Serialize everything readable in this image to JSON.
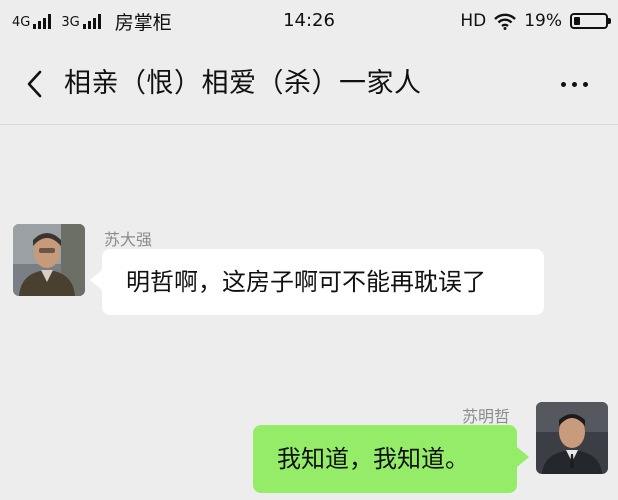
{
  "status_bar": {
    "network1": "4G",
    "network2": "3G",
    "carrier": "房掌柜",
    "time": "14:26",
    "hd": "HD",
    "battery_percent": "19%",
    "battery_level": 0.19
  },
  "header": {
    "title": "相亲（恨）相爱（杀）一家人",
    "back_icon": "chevron-left-icon",
    "more_icon": "more-dots-icon"
  },
  "messages": [
    {
      "sender": "苏大强",
      "text": "明哲啊，这房子啊可不能再耽误了",
      "direction": "incoming"
    },
    {
      "sender": "苏明哲",
      "text": "我知道，我知道。",
      "direction": "outgoing"
    }
  ],
  "colors": {
    "background": "#ededed",
    "incoming_bubble": "#ffffff",
    "outgoing_bubble": "#95ec69",
    "sender_name": "#8c8c8c"
  }
}
